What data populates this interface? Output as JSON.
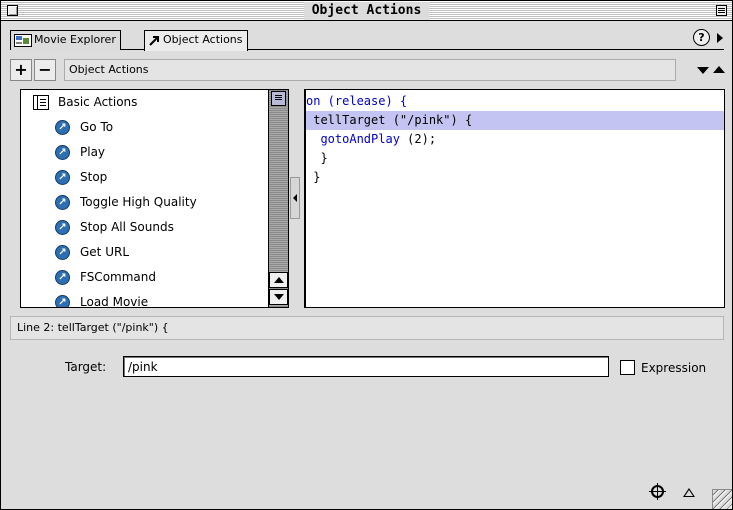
{
  "window": {
    "title": "Object Actions"
  },
  "tabs": [
    {
      "label": "Movie Explorer",
      "icon": "movie-explorer-icon"
    },
    {
      "label": "Object Actions",
      "icon": "object-actions-icon"
    }
  ],
  "help_label": "?",
  "toolbar": {
    "add_label": "+",
    "remove_label": "−",
    "title": "Object Actions"
  },
  "actions_list": {
    "category": "Basic Actions",
    "items": [
      "Go To",
      "Play",
      "Stop",
      "Toggle High Quality",
      "Stop All Sounds",
      "Get URL",
      "FSCommand",
      "Load Movie"
    ]
  },
  "code_lines": [
    {
      "indent": "",
      "keyword": "on",
      "rest": " (release) {",
      "highlight": false
    },
    {
      "indent": " ",
      "keyword": "tellTarget",
      "rest": " (\"/pink\") {",
      "highlight": true
    },
    {
      "indent": "  ",
      "keyword": "gotoAndPlay",
      "rest": " (2);",
      "highlight": false
    },
    {
      "indent": "  ",
      "keyword": "",
      "rest": "}",
      "highlight": false
    },
    {
      "indent": " ",
      "keyword": "",
      "rest": "}",
      "highlight": false
    }
  ],
  "status": "Line 2: tellTarget (\"/pink\") {",
  "parameters": {
    "target_label": "Target:",
    "target_value": "/pink",
    "expression_label": "Expression",
    "expression_checked": false
  },
  "colors": {
    "keyword": "#0000cc",
    "highlight": "#c4c4f2",
    "action_icon": "#2d6fb3"
  }
}
